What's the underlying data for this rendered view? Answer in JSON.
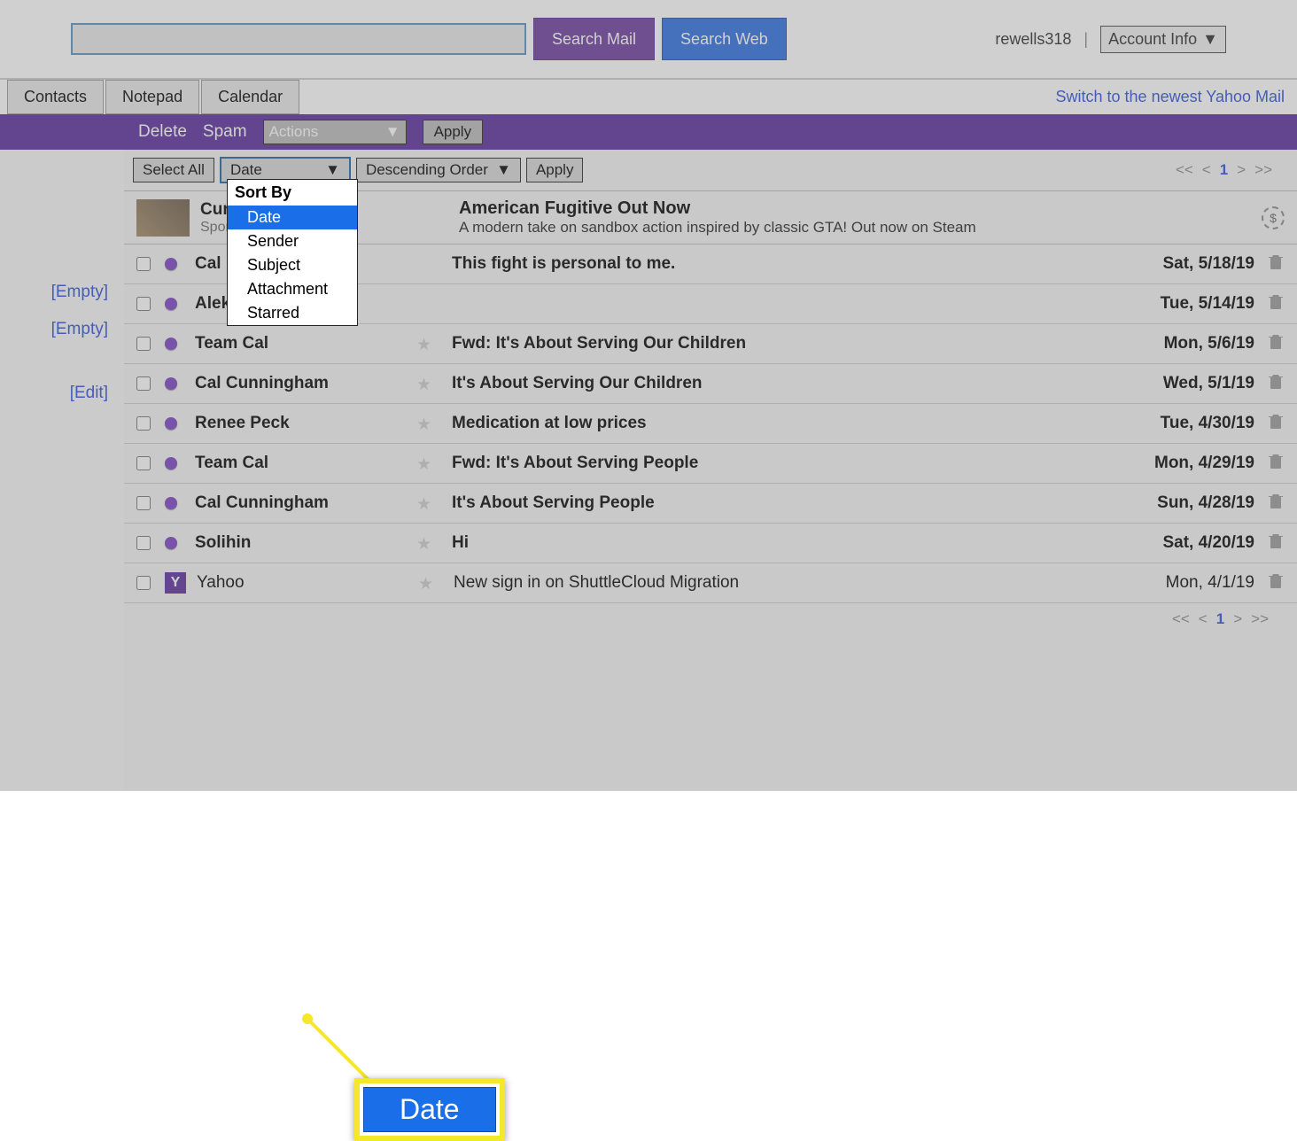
{
  "topbar": {
    "search_placeholder": "",
    "search_mail_label": "Search Mail",
    "search_web_label": "Search Web",
    "username": "rewells318",
    "account_info_label": "Account Info"
  },
  "tabs": {
    "contacts": "Contacts",
    "notepad": "Notepad",
    "calendar": "Calendar",
    "newest_link": "Switch to the newest Yahoo Mail"
  },
  "actionbar": {
    "delete": "Delete",
    "spam": "Spam",
    "actions_label": "Actions",
    "apply": "Apply"
  },
  "sortrow": {
    "select_all": "Select All",
    "sort_value": "Date",
    "order_value": "Descending Order",
    "apply": "Apply"
  },
  "sort_dropdown": {
    "header": "Sort By",
    "options": [
      "Date",
      "Sender",
      "Subject",
      "Attachment",
      "Starred"
    ],
    "selected": "Date"
  },
  "callout_label": "Date",
  "pagination": {
    "first": "<<",
    "prev": "<",
    "page": "1",
    "next": ">",
    "last": ">>"
  },
  "sidebar": {
    "items": [
      "[Empty]",
      "[Empty]",
      "[Edit]"
    ]
  },
  "sponsored": {
    "name": "Curv…",
    "tag": "Spon…",
    "title": "American Fugitive Out Now",
    "desc": "A modern take on sandbox action inspired by classic GTA! Out now on Steam"
  },
  "emails": [
    {
      "from": "Cal",
      "subject": "This fight is personal to me.",
      "date": "Sat, 5/18/19",
      "no_star": true
    },
    {
      "from": "Aleksandra",
      "subject": "",
      "date": "Tue, 5/14/19",
      "no_star": true
    },
    {
      "from": "Team Cal",
      "subject": "Fwd: It's About Serving Our Children",
      "date": "Mon, 5/6/19"
    },
    {
      "from": "Cal Cunningham",
      "subject": "It's About Serving Our Children",
      "date": "Wed, 5/1/19"
    },
    {
      "from": "Renee Peck",
      "subject": "Medication at low prices",
      "date": "Tue, 4/30/19"
    },
    {
      "from": "Team Cal",
      "subject": "Fwd: It's About Serving People",
      "date": "Mon, 4/29/19"
    },
    {
      "from": "Cal Cunningham",
      "subject": "It's About Serving People",
      "date": "Sun, 4/28/19"
    },
    {
      "from": "Solihin",
      "subject": "Hi",
      "date": "Sat, 4/20/19"
    },
    {
      "from": "Yahoo",
      "subject": "New sign in on ShuttleCloud Migration",
      "date": "Mon, 4/1/19",
      "yahoo": true,
      "read": true
    }
  ]
}
